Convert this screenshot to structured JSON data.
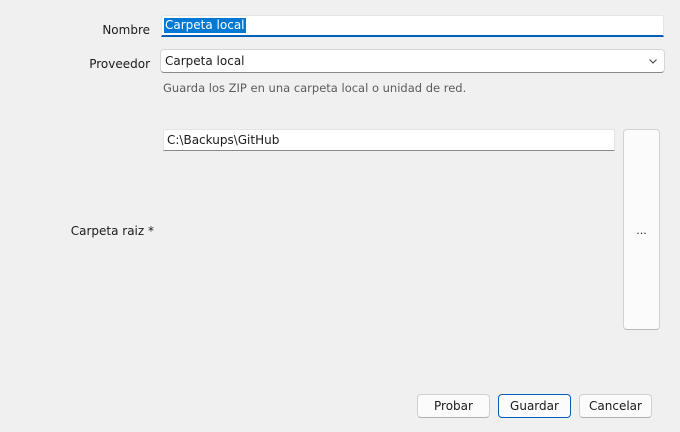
{
  "form": {
    "name_label": "Nombre",
    "name_value": "Carpeta local",
    "provider_label": "Proveedor",
    "provider_value": "Carpeta local",
    "provider_hint": "Guarda los ZIP en una carpeta local o unidad de red.",
    "root_label": "Carpeta raiz *",
    "root_value": "C:\\Backups\\GitHub",
    "browse_label": "..."
  },
  "buttons": {
    "test_label": "Probar",
    "save_label": "Guardar",
    "cancel_label": "Cancelar"
  },
  "icons": {
    "provider_dropdown": "chevron-down-icon"
  },
  "colors": {
    "accent": "#005fb8",
    "selection": "#0078d4",
    "background": "#f0f0f0"
  }
}
